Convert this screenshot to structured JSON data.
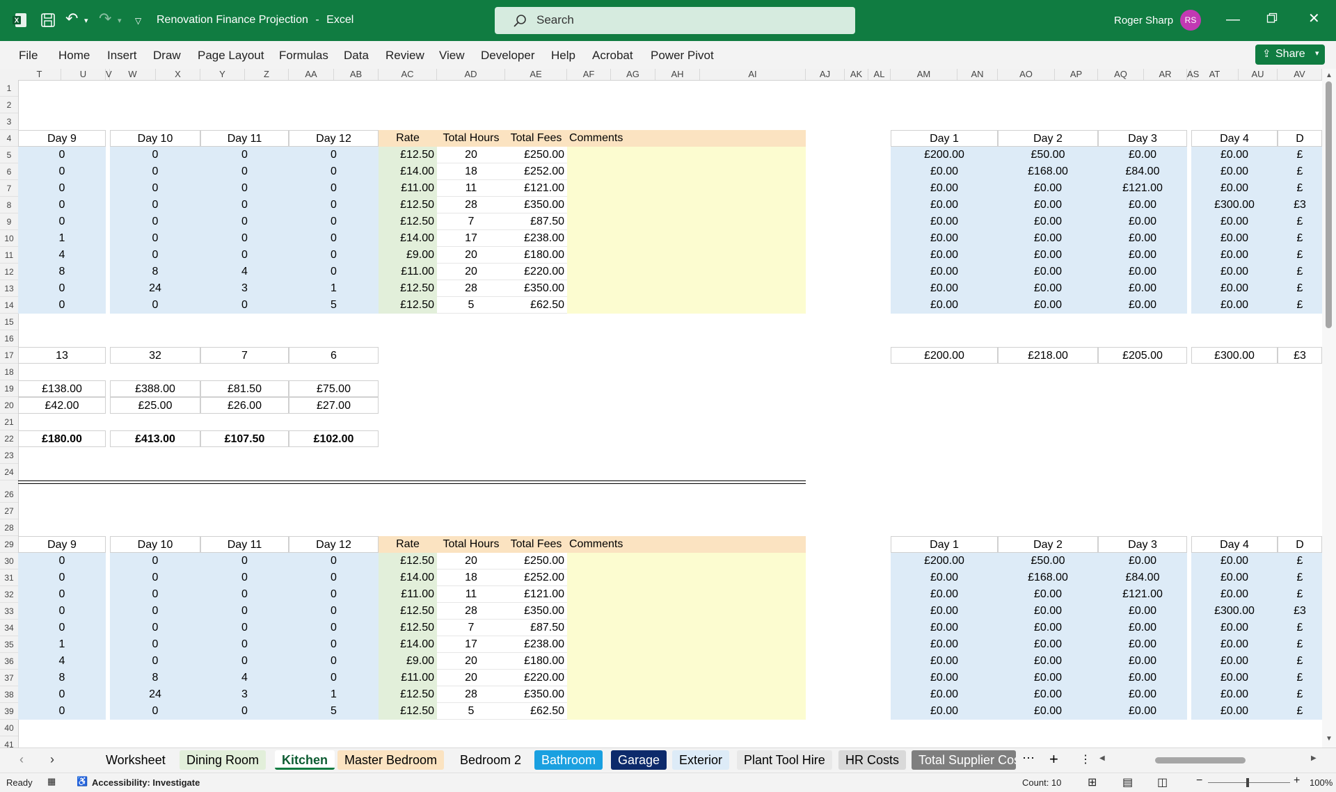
{
  "app": {
    "document_title": "Renovation Finance Projection",
    "separator": "-",
    "app_name": "Excel",
    "user_name": "Roger Sharp",
    "user_initials": "RS"
  },
  "search": {
    "placeholder": "Search"
  },
  "ribbon": {
    "tabs": [
      "File",
      "Home",
      "Insert",
      "Draw",
      "Page Layout",
      "Formulas",
      "Data",
      "Review",
      "View",
      "Developer",
      "Help",
      "Acrobat",
      "Power Pivot"
    ],
    "share_label": "Share"
  },
  "columns": [
    "T",
    "U",
    "V",
    "W",
    "X",
    "Y",
    "Z",
    "AA",
    "AB",
    "AC",
    "AD",
    "AE",
    "AF",
    "AG",
    "AH",
    "AI",
    "AJ",
    "AK",
    "AL",
    "AM",
    "AN",
    "AO",
    "AP",
    "AQ",
    "AR",
    "AS",
    "AT",
    "AU",
    "AV"
  ],
  "rows": [
    "1",
    "2",
    "3",
    "4",
    "5",
    "6",
    "7",
    "8",
    "9",
    "10",
    "11",
    "12",
    "13",
    "14",
    "15",
    "16",
    "17",
    "18",
    "19",
    "20",
    "21",
    "22",
    "23",
    "24",
    "26",
    "27",
    "28",
    "29",
    "30",
    "31",
    "32",
    "33",
    "34",
    "35",
    "36",
    "37",
    "38",
    "39",
    "40",
    "41"
  ],
  "table": {
    "headers": [
      "Day 9",
      "Day 10",
      "Day 11",
      "Day 12",
      "Rate",
      "Total Hours",
      "Total Fees",
      "Comments"
    ],
    "rows": [
      [
        "0",
        "0",
        "0",
        "0",
        "£12.50",
        "20",
        "£250.00"
      ],
      [
        "0",
        "0",
        "0",
        "0",
        "£14.00",
        "18",
        "£252.00"
      ],
      [
        "0",
        "0",
        "0",
        "0",
        "£11.00",
        "11",
        "£121.00"
      ],
      [
        "0",
        "0",
        "0",
        "0",
        "£12.50",
        "28",
        "£350.00"
      ],
      [
        "0",
        "0",
        "0",
        "0",
        "£12.50",
        "7",
        "£87.50"
      ],
      [
        "1",
        "0",
        "0",
        "0",
        "£14.00",
        "17",
        "£238.00"
      ],
      [
        "4",
        "0",
        "0",
        "0",
        "£9.00",
        "20",
        "£180.00"
      ],
      [
        "8",
        "8",
        "4",
        "0",
        "£11.00",
        "20",
        "£220.00"
      ],
      [
        "0",
        "24",
        "3",
        "1",
        "£12.50",
        "28",
        "£350.00"
      ],
      [
        "0",
        "0",
        "0",
        "5",
        "£12.50",
        "5",
        "£62.50"
      ]
    ],
    "totals_hours": [
      "13",
      "32",
      "7",
      "6"
    ],
    "costs_a": [
      "£138.00",
      "£388.00",
      "£81.50",
      "£75.00"
    ],
    "costs_b": [
      "£42.00",
      "£25.00",
      "£26.00",
      "£27.00"
    ],
    "totals_cost": [
      "£180.00",
      "£413.00",
      "£107.50",
      "£102.00"
    ]
  },
  "right_table": {
    "headers": [
      "Day 1",
      "Day 2",
      "Day 3",
      "Day 4",
      "D"
    ],
    "rows": [
      [
        "£200.00",
        "£50.00",
        "£0.00",
        "£0.00",
        "£"
      ],
      [
        "£0.00",
        "£168.00",
        "£84.00",
        "£0.00",
        "£"
      ],
      [
        "£0.00",
        "£0.00",
        "£121.00",
        "£0.00",
        "£"
      ],
      [
        "£0.00",
        "£0.00",
        "£0.00",
        "£300.00",
        "£3"
      ],
      [
        "£0.00",
        "£0.00",
        "£0.00",
        "£0.00",
        "£"
      ],
      [
        "£0.00",
        "£0.00",
        "£0.00",
        "£0.00",
        "£"
      ],
      [
        "£0.00",
        "£0.00",
        "£0.00",
        "£0.00",
        "£"
      ],
      [
        "£0.00",
        "£0.00",
        "£0.00",
        "£0.00",
        "£"
      ],
      [
        "£0.00",
        "£0.00",
        "£0.00",
        "£0.00",
        "£"
      ],
      [
        "£0.00",
        "£0.00",
        "£0.00",
        "£0.00",
        "£"
      ]
    ],
    "totals": [
      "£200.00",
      "£218.00",
      "£205.00",
      "£300.00",
      "£3"
    ]
  },
  "sheets": [
    "Worksheet",
    "Dining Room",
    "Kitchen",
    "Master Bedroom",
    "Bedroom 2",
    "Bathroom",
    "Garage",
    "Exterior",
    "Plant Tool Hire",
    "HR Costs",
    "Total Supplier Cos"
  ],
  "active_sheet": "Kitchen",
  "status": {
    "ready": "Ready",
    "accessibility": "Accessibility: Investigate",
    "count": "Count: 10",
    "zoom": "100%"
  },
  "colors": {
    "title_bar": "#107c41",
    "blue_fill": "#ddebf7",
    "green_fill": "#e2efda",
    "yellow_fill": "#fcfcd0",
    "orange_fill": "#fbe3c1"
  }
}
